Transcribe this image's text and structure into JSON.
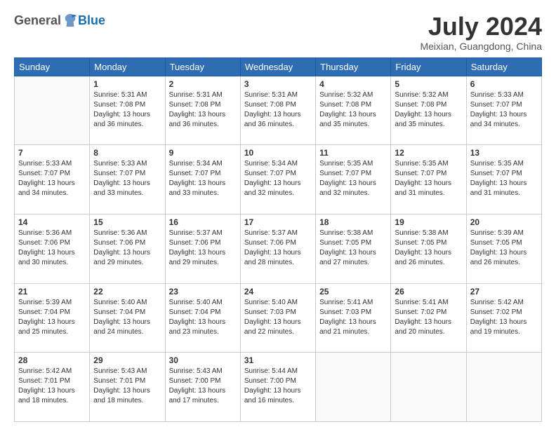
{
  "logo": {
    "general": "General",
    "blue": "Blue"
  },
  "header": {
    "month": "July 2024",
    "location": "Meixian, Guangdong, China"
  },
  "weekdays": [
    "Sunday",
    "Monday",
    "Tuesday",
    "Wednesday",
    "Thursday",
    "Friday",
    "Saturday"
  ],
  "weeks": [
    [
      {
        "day": "",
        "empty": true
      },
      {
        "day": "1",
        "sunrise": "5:31 AM",
        "sunset": "7:08 PM",
        "daylight": "13 hours and 36 minutes."
      },
      {
        "day": "2",
        "sunrise": "5:31 AM",
        "sunset": "7:08 PM",
        "daylight": "13 hours and 36 minutes."
      },
      {
        "day": "3",
        "sunrise": "5:31 AM",
        "sunset": "7:08 PM",
        "daylight": "13 hours and 36 minutes."
      },
      {
        "day": "4",
        "sunrise": "5:32 AM",
        "sunset": "7:08 PM",
        "daylight": "13 hours and 35 minutes."
      },
      {
        "day": "5",
        "sunrise": "5:32 AM",
        "sunset": "7:08 PM",
        "daylight": "13 hours and 35 minutes."
      },
      {
        "day": "6",
        "sunrise": "5:33 AM",
        "sunset": "7:07 PM",
        "daylight": "13 hours and 34 minutes."
      }
    ],
    [
      {
        "day": "7",
        "sunrise": "5:33 AM",
        "sunset": "7:07 PM",
        "daylight": "13 hours and 34 minutes."
      },
      {
        "day": "8",
        "sunrise": "5:33 AM",
        "sunset": "7:07 PM",
        "daylight": "13 hours and 33 minutes."
      },
      {
        "day": "9",
        "sunrise": "5:34 AM",
        "sunset": "7:07 PM",
        "daylight": "13 hours and 33 minutes."
      },
      {
        "day": "10",
        "sunrise": "5:34 AM",
        "sunset": "7:07 PM",
        "daylight": "13 hours and 32 minutes."
      },
      {
        "day": "11",
        "sunrise": "5:35 AM",
        "sunset": "7:07 PM",
        "daylight": "13 hours and 32 minutes."
      },
      {
        "day": "12",
        "sunrise": "5:35 AM",
        "sunset": "7:07 PM",
        "daylight": "13 hours and 31 minutes."
      },
      {
        "day": "13",
        "sunrise": "5:35 AM",
        "sunset": "7:07 PM",
        "daylight": "13 hours and 31 minutes."
      }
    ],
    [
      {
        "day": "14",
        "sunrise": "5:36 AM",
        "sunset": "7:06 PM",
        "daylight": "13 hours and 30 minutes."
      },
      {
        "day": "15",
        "sunrise": "5:36 AM",
        "sunset": "7:06 PM",
        "daylight": "13 hours and 29 minutes."
      },
      {
        "day": "16",
        "sunrise": "5:37 AM",
        "sunset": "7:06 PM",
        "daylight": "13 hours and 29 minutes."
      },
      {
        "day": "17",
        "sunrise": "5:37 AM",
        "sunset": "7:06 PM",
        "daylight": "13 hours and 28 minutes."
      },
      {
        "day": "18",
        "sunrise": "5:38 AM",
        "sunset": "7:05 PM",
        "daylight": "13 hours and 27 minutes."
      },
      {
        "day": "19",
        "sunrise": "5:38 AM",
        "sunset": "7:05 PM",
        "daylight": "13 hours and 26 minutes."
      },
      {
        "day": "20",
        "sunrise": "5:39 AM",
        "sunset": "7:05 PM",
        "daylight": "13 hours and 26 minutes."
      }
    ],
    [
      {
        "day": "21",
        "sunrise": "5:39 AM",
        "sunset": "7:04 PM",
        "daylight": "13 hours and 25 minutes."
      },
      {
        "day": "22",
        "sunrise": "5:40 AM",
        "sunset": "7:04 PM",
        "daylight": "13 hours and 24 minutes."
      },
      {
        "day": "23",
        "sunrise": "5:40 AM",
        "sunset": "7:04 PM",
        "daylight": "13 hours and 23 minutes."
      },
      {
        "day": "24",
        "sunrise": "5:40 AM",
        "sunset": "7:03 PM",
        "daylight": "13 hours and 22 minutes."
      },
      {
        "day": "25",
        "sunrise": "5:41 AM",
        "sunset": "7:03 PM",
        "daylight": "13 hours and 21 minutes."
      },
      {
        "day": "26",
        "sunrise": "5:41 AM",
        "sunset": "7:02 PM",
        "daylight": "13 hours and 20 minutes."
      },
      {
        "day": "27",
        "sunrise": "5:42 AM",
        "sunset": "7:02 PM",
        "daylight": "13 hours and 19 minutes."
      }
    ],
    [
      {
        "day": "28",
        "sunrise": "5:42 AM",
        "sunset": "7:01 PM",
        "daylight": "13 hours and 18 minutes."
      },
      {
        "day": "29",
        "sunrise": "5:43 AM",
        "sunset": "7:01 PM",
        "daylight": "13 hours and 18 minutes."
      },
      {
        "day": "30",
        "sunrise": "5:43 AM",
        "sunset": "7:00 PM",
        "daylight": "13 hours and 17 minutes."
      },
      {
        "day": "31",
        "sunrise": "5:44 AM",
        "sunset": "7:00 PM",
        "daylight": "13 hours and 16 minutes."
      },
      {
        "day": "",
        "empty": true
      },
      {
        "day": "",
        "empty": true
      },
      {
        "day": "",
        "empty": true
      }
    ]
  ]
}
